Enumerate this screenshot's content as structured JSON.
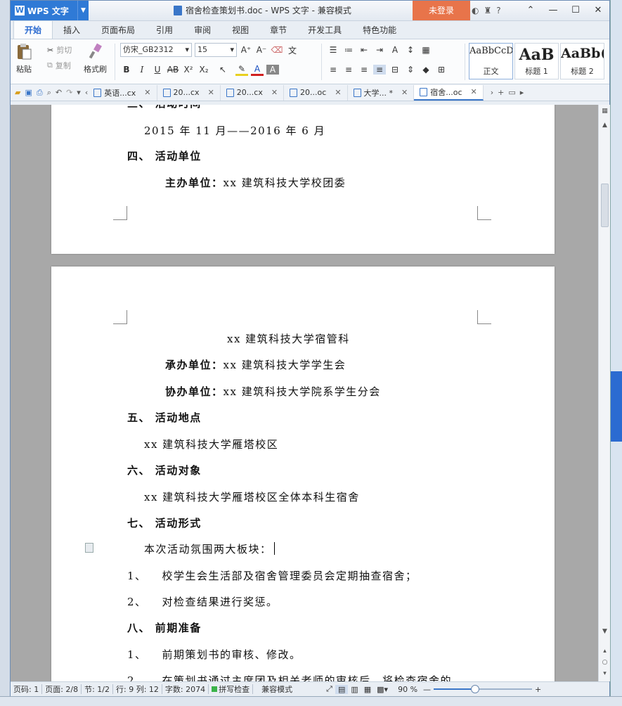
{
  "app": {
    "brand": "WPS 文字",
    "title": "宿舍检查策划书.doc - WPS 文字 - 兼容模式",
    "login_label": "未登录",
    "help_label": "?"
  },
  "menu_tabs": [
    "开始",
    "插入",
    "页面布局",
    "引用",
    "审阅",
    "视图",
    "章节",
    "开发工具",
    "特色功能"
  ],
  "ribbon": {
    "paste": "粘贴",
    "cut": "剪切",
    "copy": "复制",
    "format_painter": "格式刷",
    "font_name": "仿宋_GB2312",
    "font_size": "15",
    "styles": [
      {
        "preview": "AaBbCcD",
        "name": "正文"
      },
      {
        "preview": "AaB",
        "name": "标题 1"
      },
      {
        "preview": "AaBb(",
        "name": "标题 2"
      }
    ]
  },
  "doc_tabs": [
    {
      "label": "英语...cx"
    },
    {
      "label": "20...cx"
    },
    {
      "label": "20...cx"
    },
    {
      "label": "20...oc"
    },
    {
      "label": "大学... *"
    },
    {
      "label": "宿舍...oc"
    }
  ],
  "document": {
    "page1": {
      "partial_heading": "三、 活动时间",
      "date": "2015 年 11 月——2016 年 6 月",
      "h4": "四、 活动单位",
      "host_label": "主办单位：",
      "host_value": "xx 建筑科技大学校团委"
    },
    "page2": {
      "host_cont": "xx 建筑科技大学宿管科",
      "org_label": "承办单位：",
      "org_value": "xx 建筑科技大学学生会",
      "co_label": "协办单位：",
      "co_value": "xx 建筑科技大学院系学生分会",
      "h5": "五、 活动地点",
      "location": "xx 建筑科技大学雁塔校区",
      "h6": "六、 活动对象",
      "target": "xx 建筑科技大学雁塔校区全体本科生宿舍",
      "h7": "七、 活动形式",
      "form_intro": "本次活动氛围两大板块：",
      "item1_num": "1、",
      "item1": "校学生会生活部及宿舍管理委员会定期抽查宿舍；",
      "item2_num": "2、",
      "item2": "对检查结果进行奖惩。",
      "h8": "八、 前期准备",
      "prep1_num": "1、",
      "prep1": "前期策划书的审核、修改。",
      "prep2_num": "2、",
      "prep2": "在策划书通过主席团及相关老师的审核后，将检查宿舍的"
    }
  },
  "status": {
    "page_no": "页码: 1",
    "pages": "页面: 2/8",
    "section": "节: 1/2",
    "rowcol": "行: 9  列: 12",
    "words": "字数: 2074",
    "spell": "拼写检查",
    "compat": "兼容模式",
    "zoom": "90 %",
    "zoom_level": 0.42
  },
  "colors": {
    "brand_blue": "#2f7ad6",
    "login_orange": "#e8744a",
    "accent_tab": "#2a6ad0"
  }
}
